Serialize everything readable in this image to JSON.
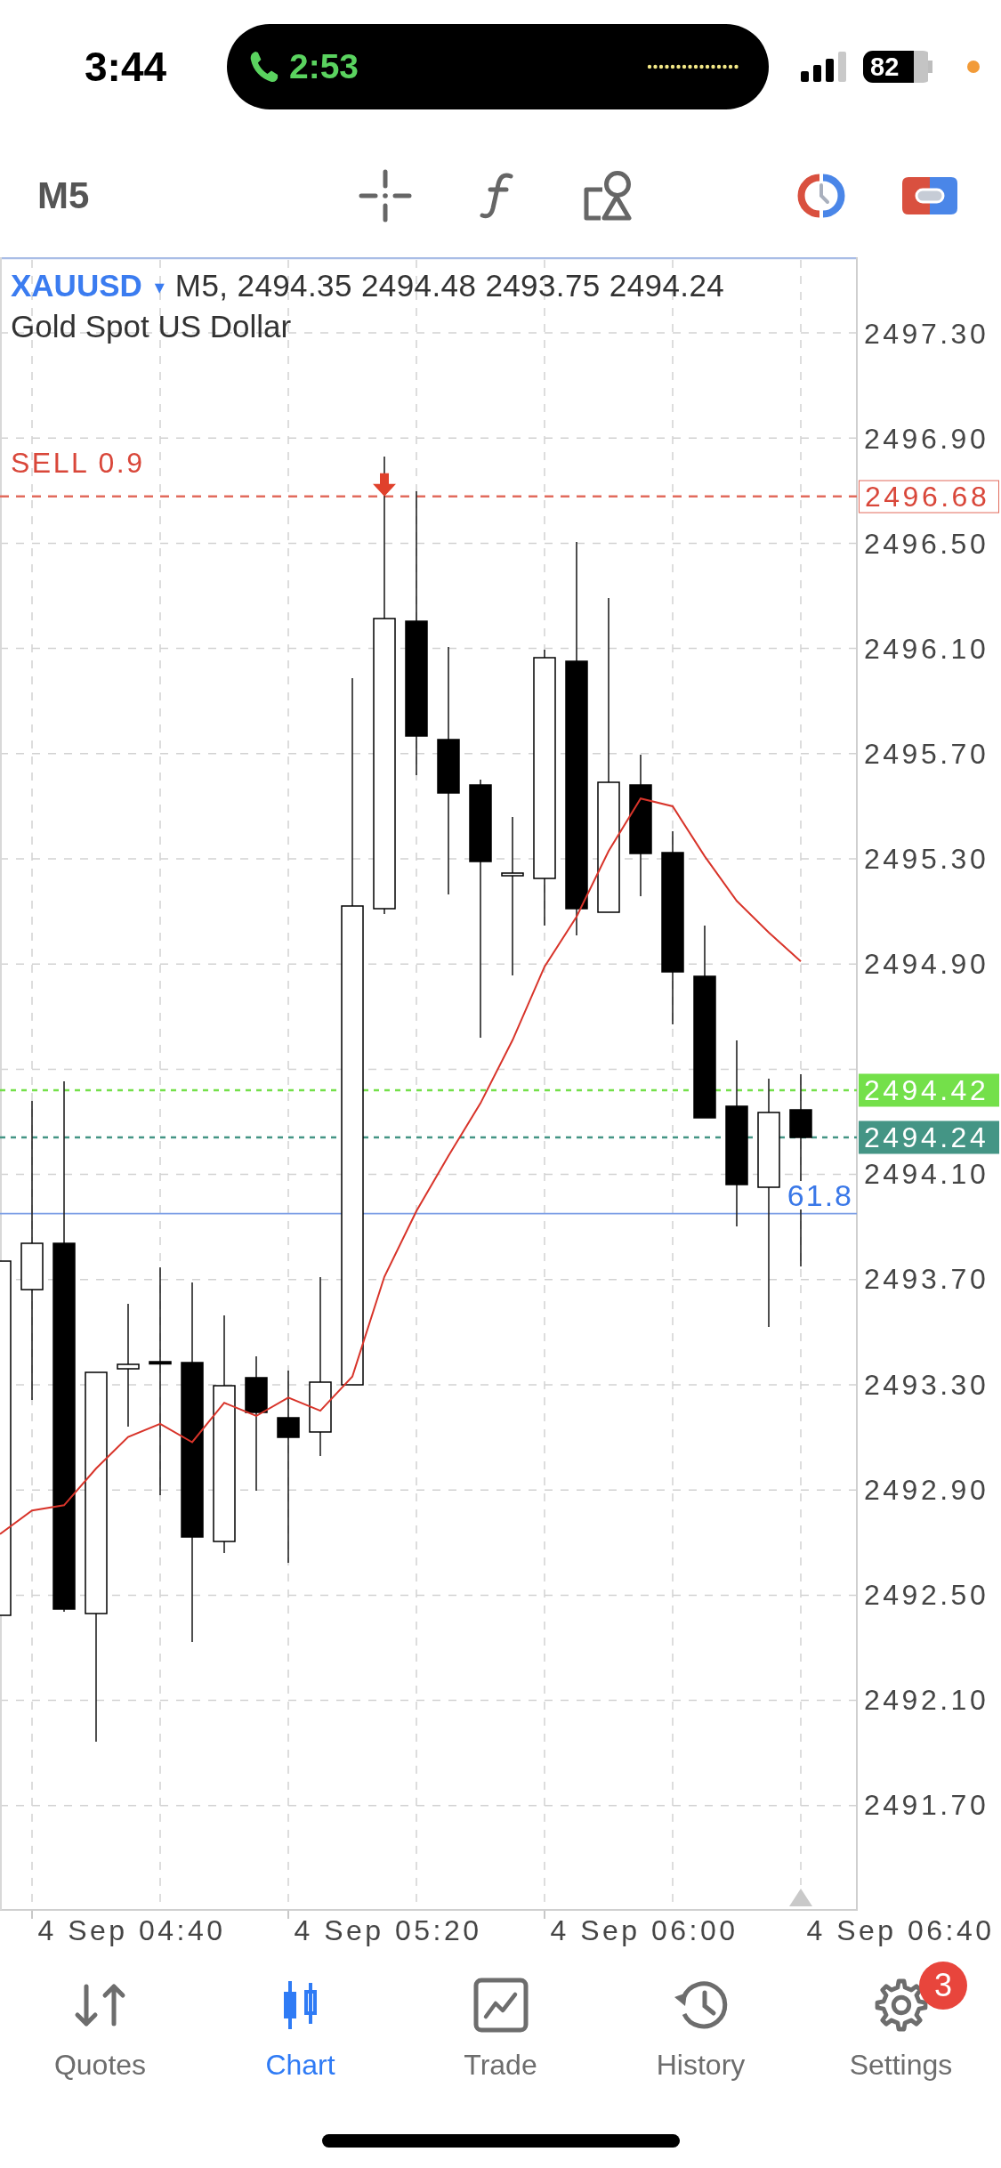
{
  "status_bar": {
    "time": "3:44",
    "call_timer": "2:53",
    "battery": "82"
  },
  "toolbar": {
    "timeframe": "M5"
  },
  "chart": {
    "symbol": "XAUUSD",
    "symbol_menu": "▾",
    "quote": "M5, 2494.35 2494.48 2493.75 2494.24",
    "description": "Gold Spot US Dollar",
    "levels": [
      {
        "kind": "order",
        "label": "SELL 0.9"
      },
      {
        "kind": "ask"
      },
      {
        "kind": "bid"
      },
      {
        "kind": "fibo",
        "label": "61.8"
      }
    ],
    "chart_data": {
      "type": "line",
      "grid": true,
      "categories": [
        null,
        null,
        null,
        null,
        "4 Sep 04:40",
        null,
        null,
        null,
        null,
        null,
        null,
        null,
        "4 Sep 05:20",
        null,
        null,
        null,
        null,
        null,
        null,
        null,
        "4 Sep 06:00",
        null,
        null,
        null,
        null,
        null,
        null,
        null,
        "4 Sep 06:40"
      ],
      "series": [
        {
          "color": "#d8342a",
          "values": [
            2492.73,
            2492.82,
            2492.84,
            2492.98,
            2493.1,
            2493.15,
            2493.08,
            2493.23,
            2493.18,
            2493.25,
            2493.2,
            2493.33,
            2493.71,
            2493.96,
            2494.17,
            2494.37,
            2494.61,
            2494.89,
            2495.08,
            2495.33,
            2495.53,
            2495.5,
            2495.31,
            2495.14,
            2495.02,
            2494.91,
            null,
            null,
            null
          ]
        }
      ],
      "ylim": [
        2491.3,
        2497.59
      ],
      "yticks": [
        {
          "value": 2497.3,
          "label": "2497.30"
        },
        {
          "value": 2496.9,
          "label": "2496.90"
        },
        {
          "value": 2496.5,
          "label": "2496.50"
        },
        {
          "value": 2496.1,
          "label": "2496.10"
        },
        {
          "value": 2495.7,
          "label": "2495.70"
        },
        {
          "value": 2495.3,
          "label": "2495.30"
        },
        {
          "value": 2494.9,
          "label": "2494.90"
        },
        {
          "value": 2494.1,
          "label": "2494.10"
        },
        {
          "value": 2493.7,
          "label": "2493.70"
        },
        {
          "value": 2493.3,
          "label": "2493.30"
        },
        {
          "value": 2492.9,
          "label": "2492.90"
        },
        {
          "value": 2492.5,
          "label": "2492.50"
        },
        {
          "value": 2492.1,
          "label": "2492.10"
        },
        {
          "value": 2491.7,
          "label": "2491.70"
        }
      ],
      "ref_lines": [
        {
          "axis": "y",
          "value": 2496.68,
          "color": "#e26b5d",
          "label": "2496.68"
        },
        {
          "axis": "y",
          "value": 2494.42,
          "color": "#74e04a",
          "label": "2494.42"
        },
        {
          "axis": "y",
          "value": 2494.24,
          "color": "#449585",
          "label": "2494.24"
        },
        {
          "axis": "y",
          "value": 2493.95,
          "color": "#7c9fe6"
        }
      ]
    }
  },
  "tabs": [
    {
      "label": "Quotes",
      "selected": false
    },
    {
      "label": "Chart",
      "selected": true
    },
    {
      "label": "Trade",
      "selected": false
    },
    {
      "label": "History",
      "selected": false
    },
    {
      "label": "Settings",
      "selected": false,
      "badge": "3"
    }
  ]
}
